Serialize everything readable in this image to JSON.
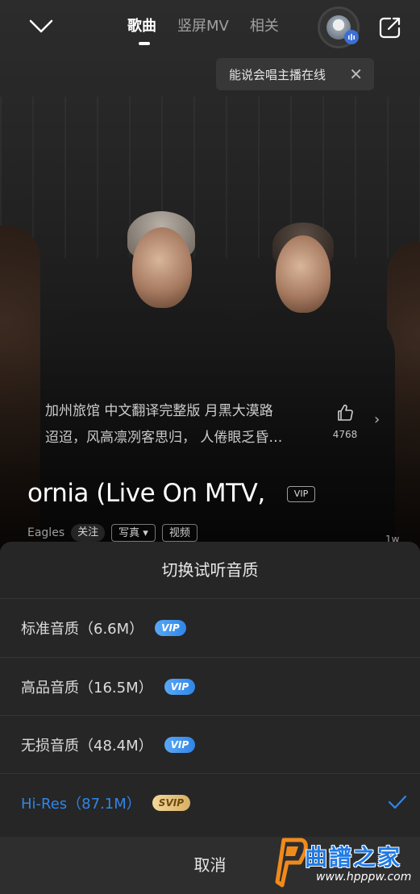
{
  "header": {
    "tabs": [
      {
        "label": "歌曲",
        "active": true
      },
      {
        "label": "竖屏MV",
        "active": false
      },
      {
        "label": "相关",
        "active": false
      }
    ]
  },
  "notice": {
    "text": "能说会唱主播在线"
  },
  "lyrics": {
    "line1": "加州旅馆 中文翻译完整版 月黑大漠路",
    "line2": "迢迢，风高凛冽客思归， 人倦眼乏昏…"
  },
  "like": {
    "count": "4768"
  },
  "song": {
    "title": "ornia (Live On MTV,",
    "vip_tag": "VIP",
    "artist": "Eagles",
    "follow": "关注",
    "photos": "写真",
    "video": "视频",
    "count_peek": "1w"
  },
  "sheet": {
    "title": "切换试听音质",
    "options": [
      {
        "label": "标准音质（6.6M）",
        "badge": "VIP",
        "selected": false
      },
      {
        "label": "高品音质（16.5M）",
        "badge": "VIP",
        "selected": false
      },
      {
        "label": "无损音质（48.4M）",
        "badge": "VIP",
        "selected": false
      },
      {
        "label": "Hi-Res（87.1M）",
        "badge": "SVIP",
        "selected": true
      }
    ],
    "cancel": "取消"
  },
  "watermark": {
    "brand": "曲譜之家",
    "url": "www.hpppw.com"
  },
  "colors": {
    "accent": "#2f86e8",
    "svip_gold": "#d8b064",
    "sheet_bg": "#262626"
  }
}
